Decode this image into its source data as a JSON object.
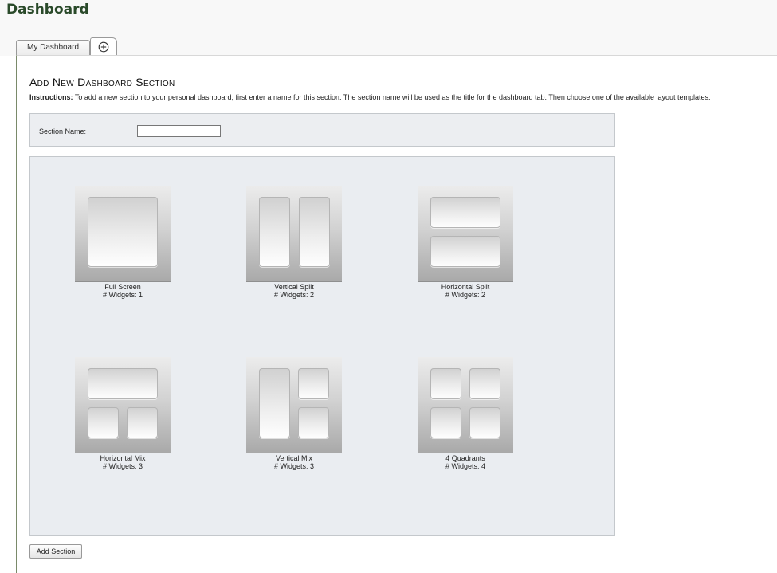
{
  "page": {
    "title": "Dashboard"
  },
  "tabs": [
    {
      "label": "My Dashboard",
      "selected": false
    },
    {
      "icon": "plus-circle-icon",
      "selected": true
    }
  ],
  "section": {
    "heading": "Add New Dashboard Section",
    "instructions_label": "Instructions:",
    "instructions_text": " To add a new section to your personal dashboard, first enter a name for this section. The section name will be used as the title for the dashboard tab. Then choose one of the available layout templates.",
    "name_label": "Section Name:",
    "name_value": ""
  },
  "layouts": [
    {
      "name": "Full Screen",
      "widgets": "# Widgets: 1"
    },
    {
      "name": "Vertical Split",
      "widgets": "# Widgets: 2"
    },
    {
      "name": "Horizontal Split",
      "widgets": "# Widgets: 2"
    },
    {
      "name": "Horizontal Mix",
      "widgets": "# Widgets: 3"
    },
    {
      "name": "Vertical Mix",
      "widgets": "# Widgets: 3"
    },
    {
      "name": "4 Quadrants",
      "widgets": "# Widgets: 4"
    }
  ],
  "actions": {
    "add_section_label": "Add Section"
  },
  "colors": {
    "title_green": "#2a4a2a",
    "panel_bg": "#eaedf1",
    "panel_border": "#c4c8cc"
  }
}
